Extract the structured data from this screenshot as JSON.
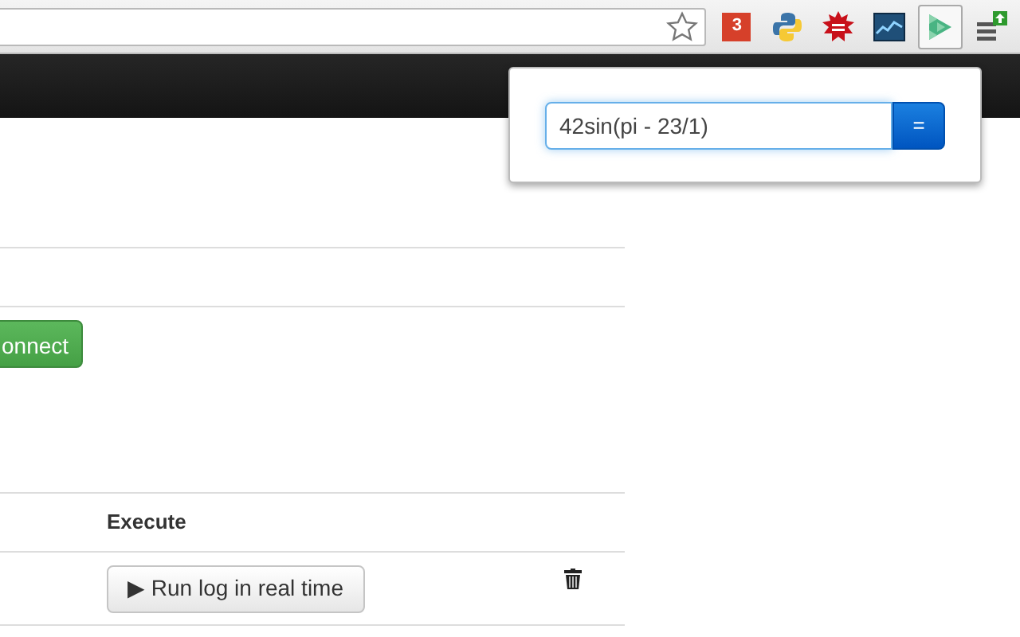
{
  "toolbar": {
    "badge_count": "3",
    "active_extension": true
  },
  "popup": {
    "expression": "42sin(pi - 23/1)",
    "button": "="
  },
  "page": {
    "connect_button": "onnect",
    "table": {
      "header": "Execute",
      "rows": [
        {
          "action": "Run log in real time",
          "play_glyph": "▶"
        }
      ]
    }
  }
}
